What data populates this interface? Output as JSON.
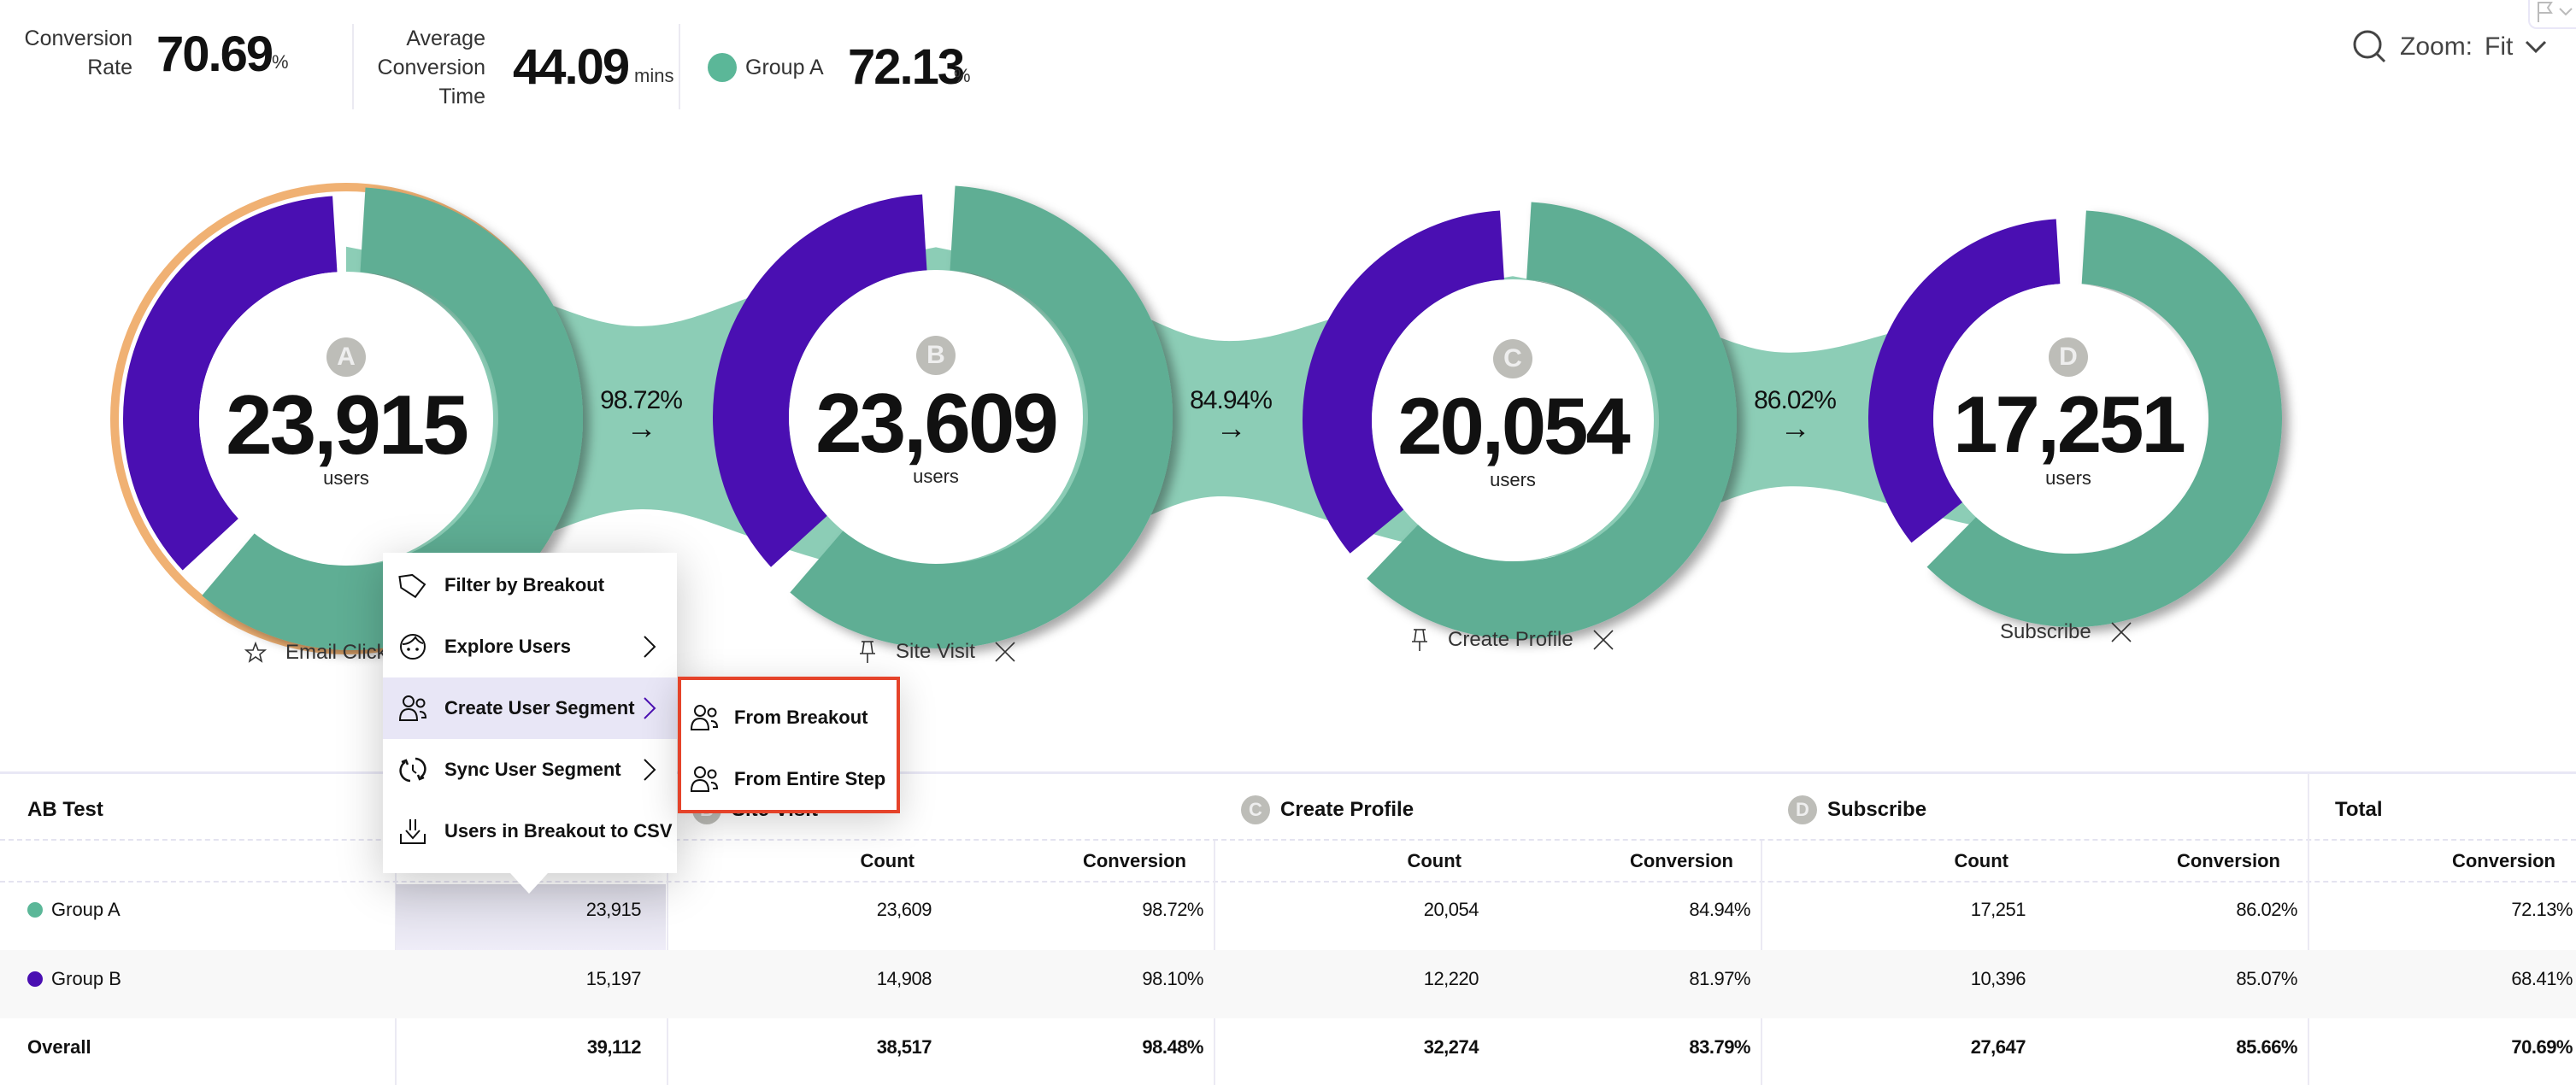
{
  "header": {
    "stats": [
      {
        "label_lines": [
          "Conversion",
          "Rate"
        ],
        "value": "70.69",
        "unit": "%"
      },
      {
        "label_lines": [
          "Average",
          "Conversion",
          "Time"
        ],
        "value": "44.09",
        "unit": "mins"
      },
      {
        "label": "Group A",
        "value": "72.13",
        "unit": "%",
        "color": "#5bb798"
      }
    ],
    "zoom": {
      "icon": "search-icon",
      "label": "Zoom:",
      "value": "Fit",
      "chevron": "chevron-down-icon"
    },
    "flag": {
      "icon": "flag-icon",
      "chevron": "chevron-down-icon"
    }
  },
  "colors": {
    "group_a": "#5fae94",
    "group_b": "#4a0fb2",
    "band": "#8ccdb6",
    "highlight_ring": "#f0b173",
    "menu_active": "#e8e6f6",
    "submenu_border": "#e5432a"
  },
  "chart_data": {
    "type": "funnel",
    "title": "",
    "steps": [
      {
        "letter": "A",
        "name": "Email Click",
        "count": "23,915",
        "count_value": 23915,
        "unit": "users",
        "name_icon": "star-icon",
        "removable": false,
        "group_a_share": 0.6115,
        "group_b_share": 0.3885,
        "conversion_to_next": "98.72%"
      },
      {
        "letter": "B",
        "name": "Site Visit",
        "count": "23,609",
        "count_value": 23609,
        "unit": "users",
        "name_icon": "pin-icon",
        "removable": true,
        "group_a_share": 0.613,
        "group_b_share": 0.387,
        "conversion_to_next": "84.94%"
      },
      {
        "letter": "C",
        "name": "Create Profile",
        "count": "20,054",
        "count_value": 20054,
        "unit": "users",
        "name_icon": "pin-icon",
        "removable": true,
        "group_a_share": 0.6214,
        "group_b_share": 0.3786,
        "conversion_to_next": "86.02%"
      },
      {
        "letter": "D",
        "name": "Subscribe",
        "count": "17,251",
        "count_value": 17251,
        "unit": "users",
        "name_icon": null,
        "removable": true,
        "group_a_share": 0.624,
        "group_b_share": 0.376,
        "conversion_to_next": null
      }
    ],
    "series": [
      {
        "name": "Group A",
        "color": "#5fae94",
        "counts": [
          23915,
          23609,
          20054,
          17251
        ]
      },
      {
        "name": "Group B",
        "color": "#4a0fb2",
        "counts": [
          15197,
          14908,
          12220,
          10396
        ]
      }
    ],
    "highlighted_step": "A",
    "highlighted_series": "Group A"
  },
  "table": {
    "breakdown_header": "AB Test",
    "steps": [
      {
        "letter": "A",
        "name": "Email Click"
      },
      {
        "letter": "B",
        "name": "Site Visit"
      },
      {
        "letter": "C",
        "name": "Create Profile"
      },
      {
        "letter": "D",
        "name": "Subscribe"
      }
    ],
    "total_header": "Total",
    "sub_headers": {
      "count": "Count",
      "conversion": "Conversion"
    },
    "rows": [
      {
        "label": "Group A",
        "color": "#5bb798",
        "a_count": "23,915",
        "b_count": "23,609",
        "b_conv": "98.72%",
        "c_count": "20,054",
        "c_conv": "84.94%",
        "d_count": "17,251",
        "d_conv": "86.02%",
        "total_conv": "72.13%"
      },
      {
        "label": "Group B",
        "color": "#4a0fb2",
        "a_count": "15,197",
        "b_count": "14,908",
        "b_conv": "98.10%",
        "c_count": "12,220",
        "c_conv": "81.97%",
        "d_count": "10,396",
        "d_conv": "85.07%",
        "total_conv": "68.41%"
      },
      {
        "label": "Overall",
        "color": null,
        "a_count": "39,112",
        "b_count": "38,517",
        "b_conv": "98.48%",
        "c_count": "32,274",
        "c_conv": "83.79%",
        "d_count": "27,647",
        "d_conv": "85.66%",
        "total_conv": "70.69%"
      }
    ]
  },
  "context_menu": {
    "items": [
      {
        "label": "Filter by Breakout",
        "icon": "tag-icon",
        "has_submenu": false
      },
      {
        "label": "Explore Users",
        "icon": "user-face-icon",
        "has_submenu": true
      },
      {
        "label": "Create User Segment",
        "icon": "users-icon",
        "has_submenu": true,
        "active": true
      },
      {
        "label": "Sync User Segment",
        "icon": "sync-icon",
        "has_submenu": true
      },
      {
        "label": "Users in Breakout to CSV",
        "icon": "download-icon",
        "has_submenu": false
      }
    ],
    "submenu": {
      "items": [
        {
          "label": "From Breakout",
          "icon": "users-icon"
        },
        {
          "label": "From Entire Step",
          "icon": "users-icon"
        }
      ]
    }
  }
}
